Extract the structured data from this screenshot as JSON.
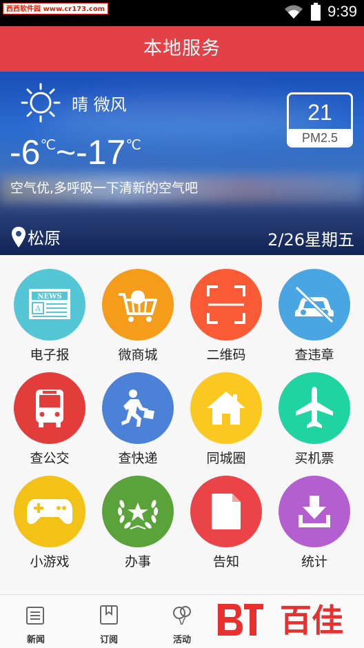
{
  "status_bar": {
    "watermark": "西西软件园 www.cr173.com",
    "time": "9:39"
  },
  "title": "本地服务",
  "weather": {
    "condition": "晴 微风",
    "temp_low": "-6",
    "temp_high": "~-17",
    "unit": "℃",
    "air_quality_text": "空气优,多呼吸一下清新的空气吧",
    "pm_value": "21",
    "pm_label": "PM2.5",
    "location": "松原",
    "date": "2/26星期五"
  },
  "services": [
    {
      "label": "电子报",
      "icon": "newspaper-icon",
      "color": "#55c6d5"
    },
    {
      "label": "微商城",
      "icon": "shopping-cart-icon",
      "color": "#f59c1b"
    },
    {
      "label": "二维码",
      "icon": "qr-scan-icon",
      "color": "#fb5b34"
    },
    {
      "label": "查违章",
      "icon": "car-violation-icon",
      "color": "#4aa6e3"
    },
    {
      "label": "查公交",
      "icon": "bus-icon",
      "color": "#e23d3a"
    },
    {
      "label": "查快递",
      "icon": "courier-icon",
      "color": "#4b82d8"
    },
    {
      "label": "同城圈",
      "icon": "home-icon",
      "color": "#fbc822"
    },
    {
      "label": "买机票",
      "icon": "airplane-icon",
      "color": "#1fd4a0"
    },
    {
      "label": "小游戏",
      "icon": "gamepad-icon",
      "color": "#f2c316"
    },
    {
      "label": "办事",
      "icon": "laurel-star-icon",
      "color": "#5aa33a"
    },
    {
      "label": "告知",
      "icon": "document-icon",
      "color": "#ea4448"
    },
    {
      "label": "统计",
      "icon": "download-icon",
      "color": "#b35fd0"
    }
  ],
  "bottom_nav": [
    {
      "label": "新闻",
      "icon": "news-icon"
    },
    {
      "label": "订阅",
      "icon": "bookmark-icon"
    },
    {
      "label": "活动",
      "icon": "balloon-icon"
    }
  ],
  "logo_text": "百佳"
}
